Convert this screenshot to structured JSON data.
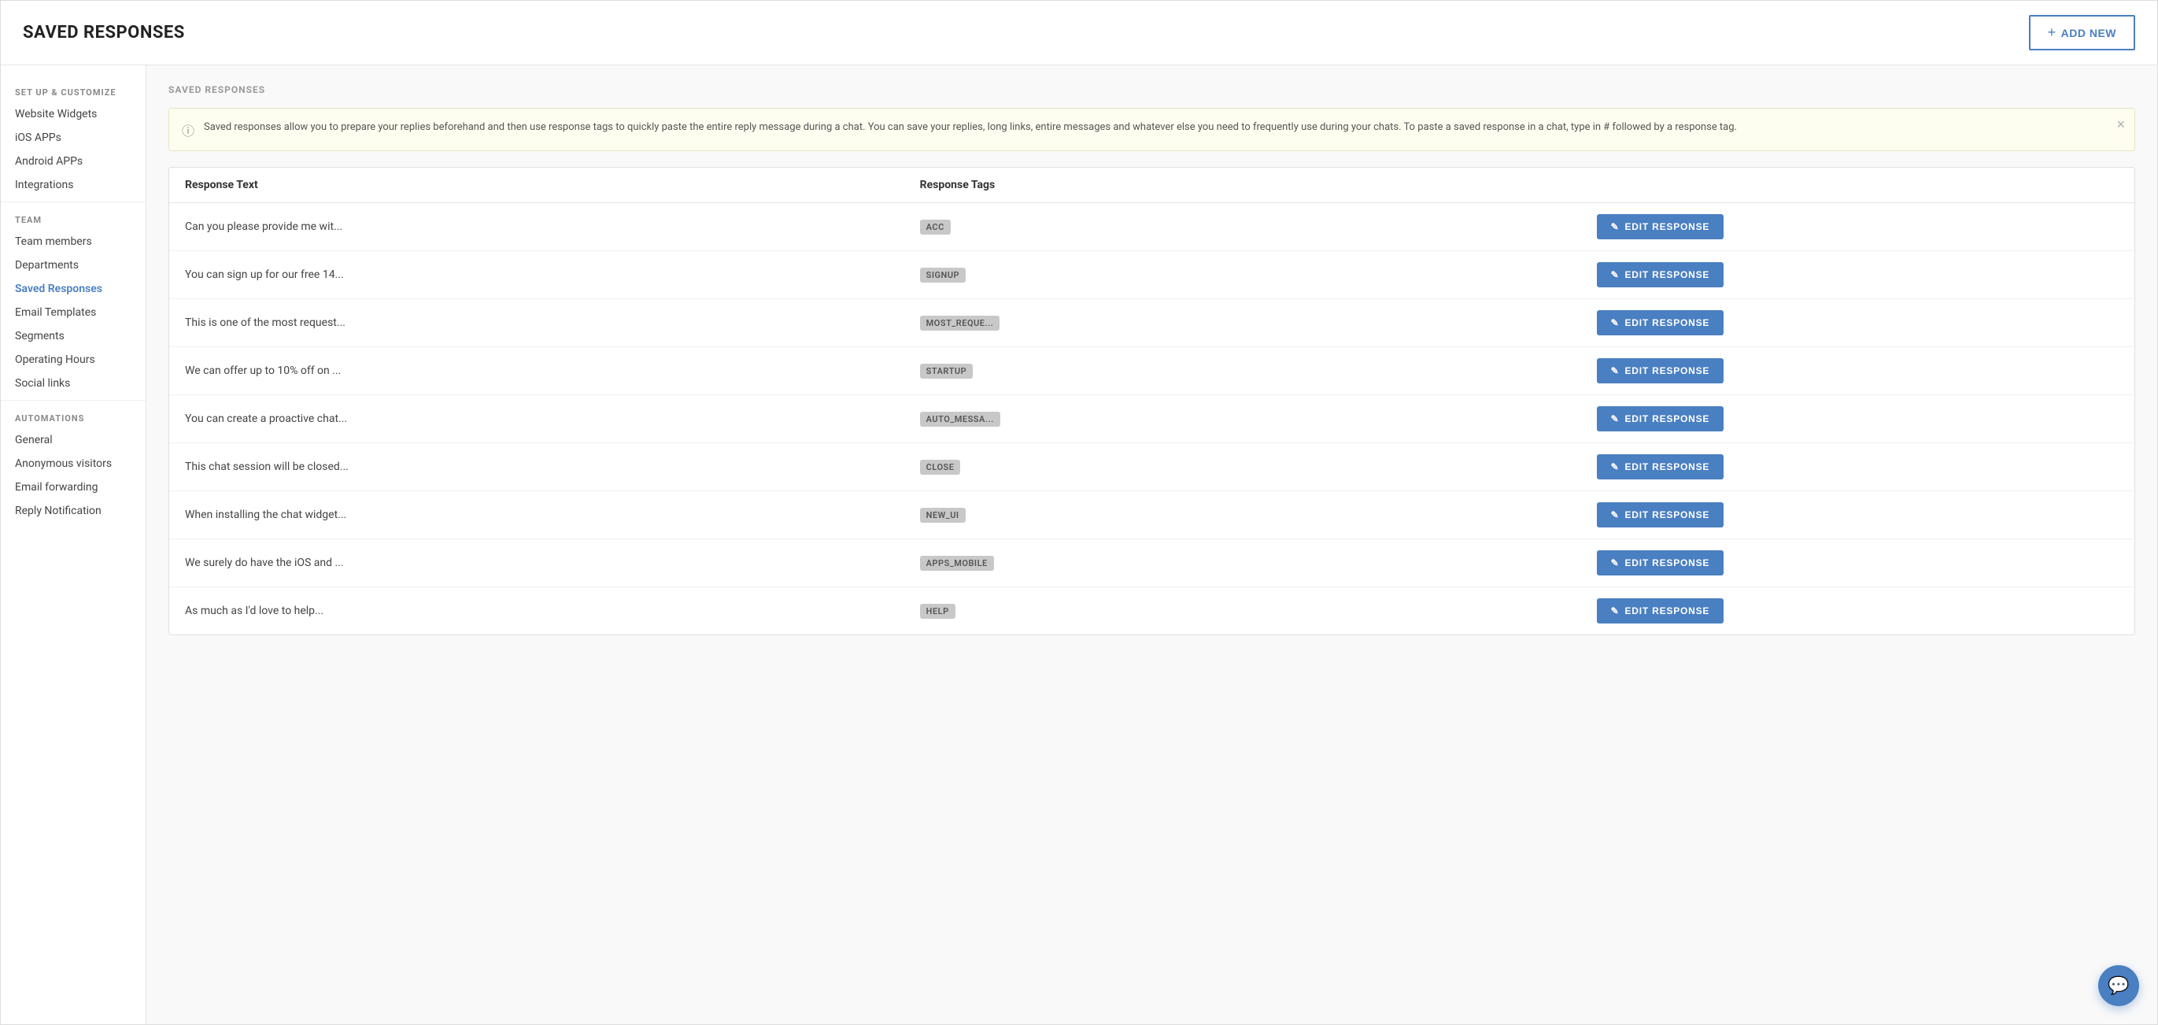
{
  "header": {
    "title": "SAVED RESPONSES",
    "add_button_label": "ADD NEW"
  },
  "sidebar": {
    "sections": [
      {
        "label": "SET UP & CUSTOMIZE",
        "items": [
          {
            "id": "website-widgets",
            "label": "Website Widgets",
            "active": false
          },
          {
            "id": "ios-apps",
            "label": "iOS APPs",
            "active": false
          },
          {
            "id": "android-apps",
            "label": "Android APPs",
            "active": false
          },
          {
            "id": "integrations",
            "label": "Integrations",
            "active": false
          }
        ]
      },
      {
        "label": "TEAM",
        "items": [
          {
            "id": "team-members",
            "label": "Team members",
            "active": false
          },
          {
            "id": "departments",
            "label": "Departments",
            "active": false
          },
          {
            "id": "saved-responses",
            "label": "Saved Responses",
            "active": true
          },
          {
            "id": "email-templates",
            "label": "Email Templates",
            "active": false
          },
          {
            "id": "segments",
            "label": "Segments",
            "active": false
          },
          {
            "id": "operating-hours",
            "label": "Operating Hours",
            "active": false
          },
          {
            "id": "social-links",
            "label": "Social links",
            "active": false
          }
        ]
      },
      {
        "label": "AUTOMATIONS",
        "items": [
          {
            "id": "general",
            "label": "General",
            "active": false
          },
          {
            "id": "anonymous-visitors",
            "label": "Anonymous visitors",
            "active": false
          },
          {
            "id": "email-forwarding",
            "label": "Email forwarding",
            "active": false
          },
          {
            "id": "reply-notification",
            "label": "Reply Notification",
            "active": false
          }
        ]
      }
    ]
  },
  "main": {
    "section_title": "SAVED RESPONSES",
    "info_text": "Saved responses allow you to prepare your replies beforehand and then use response tags to quickly paste the entire reply message during a chat. You can save your replies, long links, entire messages and whatever else you need to frequently use during your chats. To paste a saved response in a chat, type in # followed by a response tag.",
    "table": {
      "columns": [
        {
          "id": "response-text",
          "label": "Response Text"
        },
        {
          "id": "response-tags",
          "label": "Response Tags"
        }
      ],
      "rows": [
        {
          "text": "Can you please provide me wit...",
          "tag": "ACC",
          "edit_label": "EDIT RESPONSE"
        },
        {
          "text": "You can sign up for our free 14...",
          "tag": "SIGNUP",
          "edit_label": "EDIT RESPONSE"
        },
        {
          "text": "This is one of the most request...",
          "tag": "MOST_REQUE...",
          "edit_label": "EDIT RESPONSE"
        },
        {
          "text": "We can offer up to 10% off on ...",
          "tag": "STARTUP",
          "edit_label": "EDIT RESPONSE"
        },
        {
          "text": "You can create a proactive chat...",
          "tag": "AUTO_MESSA...",
          "edit_label": "EDIT RESPONSE"
        },
        {
          "text": "This chat session will be closed...",
          "tag": "CLOSE",
          "edit_label": "EDIT RESPONSE"
        },
        {
          "text": "When installing the chat widget...",
          "tag": "NEW_UI",
          "edit_label": "EDIT RESPONSE"
        },
        {
          "text": "We surely do have the iOS and ...",
          "tag": "APPS_MOBILE",
          "edit_label": "EDIT RESPONSE"
        },
        {
          "text": "As much as I'd love to help...",
          "tag": "HELP",
          "edit_label": "EDIT RESPONSE"
        }
      ]
    }
  },
  "icons": {
    "plus": "+",
    "pencil": "✎",
    "info": "ⓘ",
    "close": "×",
    "chat": "💬"
  }
}
